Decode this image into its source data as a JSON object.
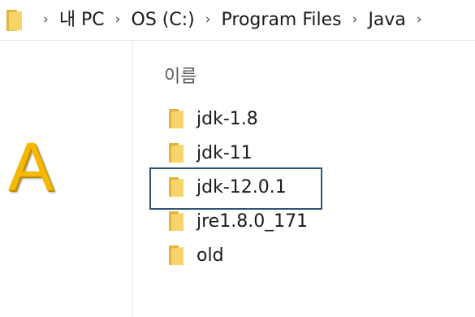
{
  "address_bar": {
    "folder_icon": "folder-icon",
    "separator": "›",
    "breadcrumbs": [
      "내 PC",
      "OS (C:)",
      "Program Files",
      "Java"
    ]
  },
  "annotation": {
    "letter": "A",
    "color": "#f5b800"
  },
  "columns": {
    "name_header": "이름"
  },
  "files": [
    {
      "name": "jdk-1.8",
      "icon": "folder-icon",
      "highlighted": false
    },
    {
      "name": "jdk-11",
      "icon": "folder-icon",
      "highlighted": false
    },
    {
      "name": "jdk-12.0.1",
      "icon": "folder-icon",
      "highlighted": true
    },
    {
      "name": "jre1.8.0_171",
      "icon": "folder-icon",
      "highlighted": false
    },
    {
      "name": "old",
      "icon": "folder-icon",
      "highlighted": false
    }
  ],
  "colors": {
    "folder": "#f7d56b",
    "folder_shade": "#e4b33b",
    "highlight_border": "#2f5475"
  }
}
